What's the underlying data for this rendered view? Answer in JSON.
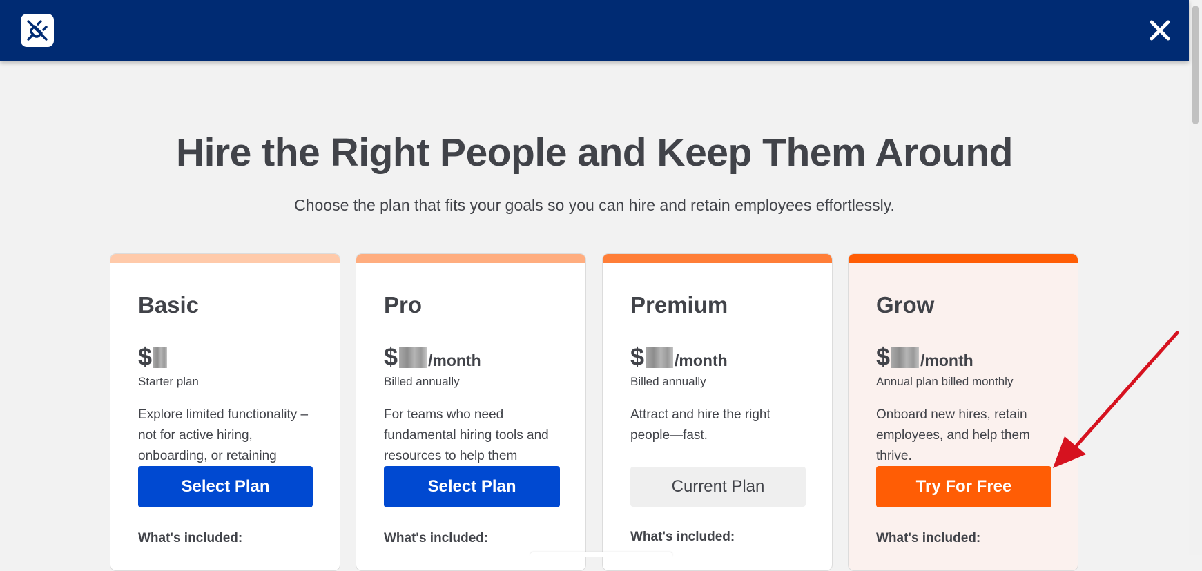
{
  "header": {
    "logo_icon": "plug-icon",
    "close_icon": "close-icon",
    "background": "#002b73"
  },
  "hero": {
    "title": "Hire the Right People and Keep Them Around",
    "subtitle": "Choose the plan that fits your goals so you can hire and retain employees effortlessly."
  },
  "plans": [
    {
      "name": "Basic",
      "currency": "$",
      "price_per": "",
      "billing": "Starter plan",
      "description": "Explore limited functionality – not for active hiring, onboarding, or retaining",
      "button_label": "Select Plan",
      "included_label": "What's included:",
      "accent": "#ffcaaa"
    },
    {
      "name": "Pro",
      "currency": "$",
      "price_per": "/month",
      "billing": "Billed annually",
      "description": "For teams who need fundamental hiring tools and resources to help them",
      "button_label": "Select Plan",
      "included_label": "What's included:",
      "accent": "#ffad7f"
    },
    {
      "name": "Premium",
      "currency": "$",
      "price_per": "/month",
      "billing": "Billed annually",
      "description": "Attract and hire the right people—fast.",
      "button_label": "Current Plan",
      "included_label": "What's included:",
      "accent": "#ff7e38"
    },
    {
      "name": "Grow",
      "currency": "$",
      "price_per": "/month",
      "billing": "Annual plan billed monthly",
      "description": "Onboard new hires, retain employees, and help them thrive.",
      "button_label": "Try For Free",
      "included_label": "What's included:",
      "accent": "#ff5d05"
    }
  ],
  "colors": {
    "primary_button": "#0049d1",
    "featured_button": "#ff5d05",
    "annotation_arrow": "#d6121f"
  }
}
